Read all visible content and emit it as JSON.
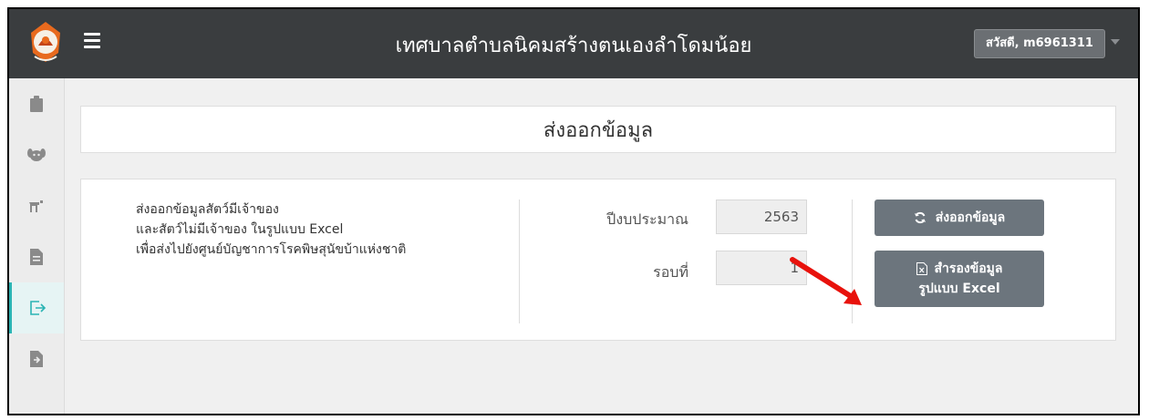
{
  "header": {
    "app_title": "เทศบาลตำบลนิคมสร้างตนเองลำโดมน้อย",
    "user_greeting": "สวัสดี, m6961311",
    "logo_icon": "municipality-logo",
    "menu_icon": "hamburger-icon"
  },
  "sidebar": {
    "items": [
      {
        "icon": "clipboard-icon",
        "active": false
      },
      {
        "icon": "dog-icon",
        "active": false
      },
      {
        "icon": "animal-icon",
        "active": false
      },
      {
        "icon": "document-icon",
        "active": false
      },
      {
        "icon": "export-icon",
        "active": true
      },
      {
        "icon": "file-import-icon",
        "active": false
      }
    ],
    "active_color": "#2ab3b3"
  },
  "page": {
    "title": "ส่งออกข้อมูล",
    "description": [
      "ส่งออกข้อมูลสัตว์มีเจ้าของ",
      "และสัตว์ไม่มีเจ้าของ ในรูปแบบ Excel",
      "เพื่อส่งไปยังศูนย์บัญชาการโรคพิษสุนัขบ้าแห่งชาติ"
    ],
    "budget_year_label": "ปีงบประมาณ",
    "budget_year_value": "2563",
    "round_label": "รอบที่",
    "round_value": "1",
    "export_button": "ส่งออกข้อมูล",
    "backup_button_line1": "สำรองข้อมูล",
    "backup_button_line2": "รูปแบบ Excel",
    "button_color": "#6c757d",
    "annotation_arrow_color": "#e8120c"
  }
}
